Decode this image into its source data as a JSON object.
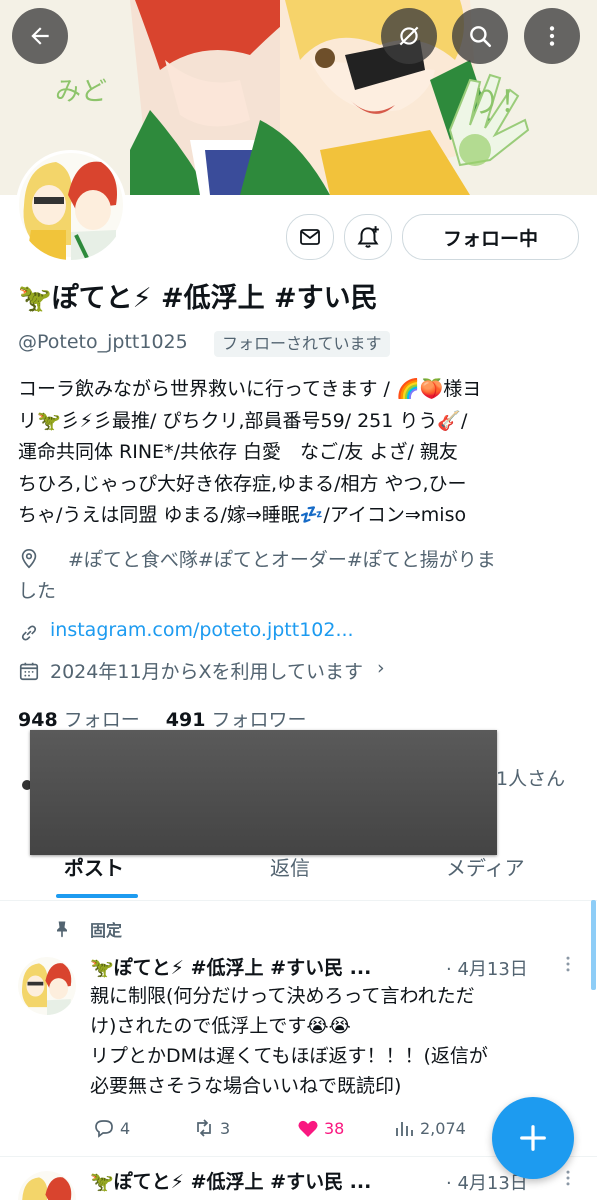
{
  "banner": {
    "text_left": "みど",
    "text_right": "り！"
  },
  "header": {
    "back_icon": "arrow-left-icon",
    "sync_icon": "sync-off-icon",
    "search_icon": "search-icon",
    "more_icon": "more-vertical-icon"
  },
  "profile": {
    "name": "🦖ぽてと⚡ #低浮上 #すい民",
    "handle": "@Poteto_jptt1025",
    "follows_you": "フォローされています",
    "follow_button": "フォロー中",
    "bio_lines": [
      "コーラ飲みながら世界救いに行ってきます / 🌈🍑様ヨ",
      "リ🦖彡⚡彡最推/ ぴちクリ,部員番号59/ 251 りう🎸/",
      "運命共同体 RINE*/共依存 白愛　なご/友 よざ/ 親友",
      "ちひろ,じゃっぴ大好き依存症,ゆまる/相方 やつ,ひー",
      "ちゃ/うえは同盟 ゆまる/嫁⇒睡眠💤/アイコン⇒miso"
    ],
    "location_line1": "#ぽてと食べ隊#ぽてとオーダー#ぽてと揚がりま",
    "location_line2": "した",
    "website": "instagram.com/poteto.jptt102...",
    "joined": "2024年11月からXを利用しています",
    "following_count": "948",
    "following_label": "フォロー",
    "followers_count": "491",
    "followers_label": "フォロワー",
    "followed_by_suffix": "1人さん"
  },
  "tabs": [
    {
      "label": "ポスト",
      "active": true
    },
    {
      "label": "返信",
      "active": false
    },
    {
      "label": "メディア",
      "active": false
    }
  ],
  "posts": [
    {
      "pinned_label": "固定",
      "author": "🦖ぽてと⚡ #低浮上 #すい民 ...",
      "date": "· 4月13日",
      "lines": [
        "親に制限(何分だけって決めろって言われただ",
        "け)されたので低浮上です😭😭",
        "リプとかDMは遅くてもほぼ返す！！！(返信が",
        "必要無さそうな場合いいねで既読印)"
      ],
      "replies": "4",
      "reposts": "3",
      "likes": "38",
      "views": "2,074",
      "liked": true
    },
    {
      "author": "🦖ぽてと⚡ #低浮上 #すい民 ...",
      "date": "· 4月13日"
    }
  ],
  "colors": {
    "accent": "#1d9bf0",
    "like": "#f91880",
    "text": "#0f1419",
    "muted": "#536471"
  },
  "fab_icon": "plus-icon"
}
